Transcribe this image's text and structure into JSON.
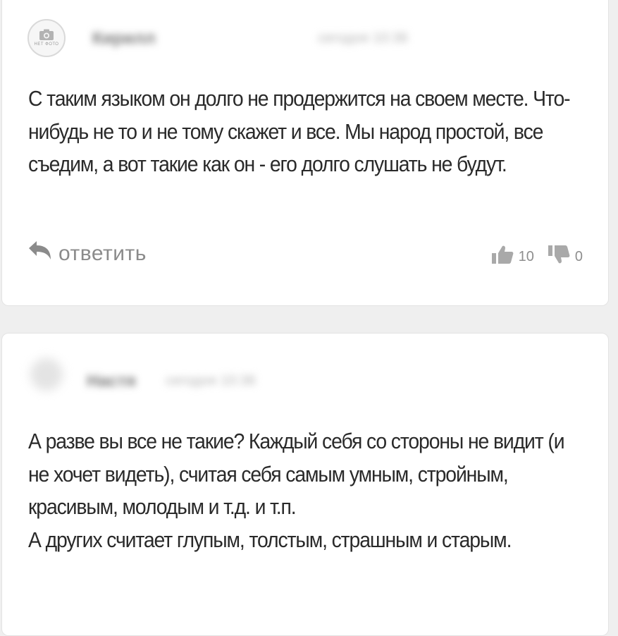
{
  "comments": [
    {
      "author": "Кирилл",
      "date": "сегодня 10:36",
      "avatar_label": "НЕТ ФОТО",
      "text": [
        "С таким языком он долго не продержится на своем месте. Что-нибудь не то и не тому скажет и все. Мы народ простой, все съедим, а вот такие как он - его долго слушать не будут."
      ],
      "reply_label": "ответить",
      "likes": "10",
      "dislikes": "0"
    },
    {
      "author": "Настя",
      "date": "сегодня 10:36",
      "text": [
        "А разве вы все не такие? Каждый себя со стороны не видит (и не хочет видеть), считая себя самым умным, стройным, красивым, молодым и т.д. и т.п.",
        "А других считает глупым, толстым, страшным и старым."
      ]
    }
  ],
  "colors": {
    "background": "#efefef",
    "card": "#ffffff",
    "text": "#2a2a2a",
    "muted": "#8b8b8b"
  },
  "icons": [
    "camera-icon",
    "reply-arrow-icon",
    "thumbs-up-icon",
    "thumbs-down-icon"
  ]
}
